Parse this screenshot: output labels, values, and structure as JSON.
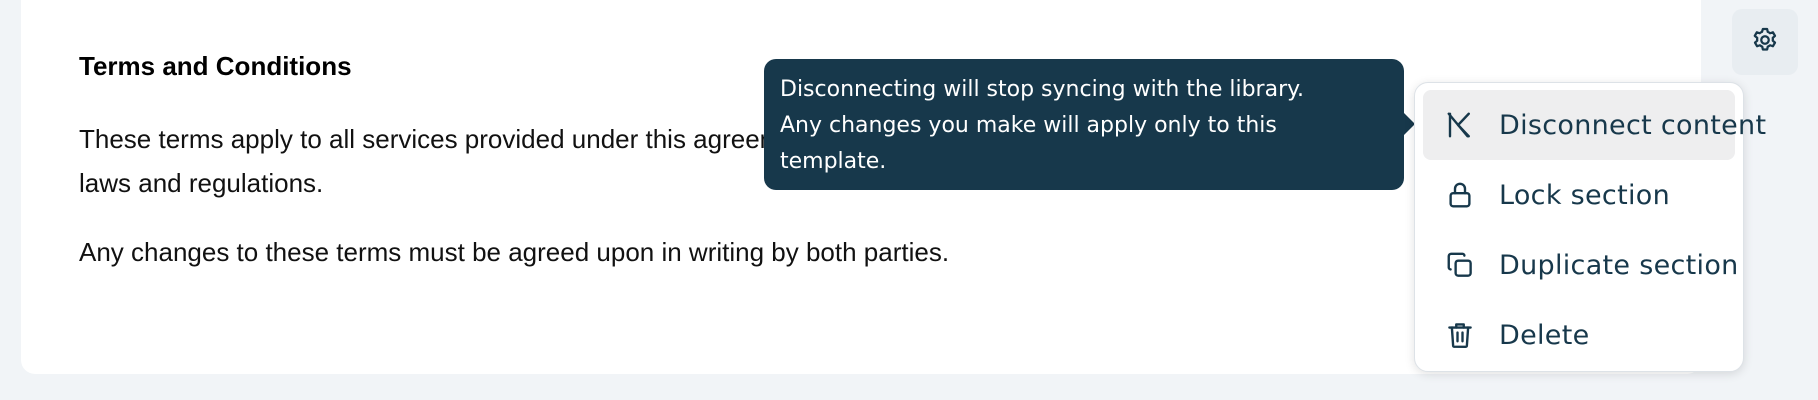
{
  "document": {
    "section_title": "Terms and Conditions",
    "paragraphs": [
      "These terms apply to all services provided under this agreement. The client agrees to comply with all applicable laws and regulations.",
      "Any changes to these terms must be agreed upon in writing by both parties."
    ]
  },
  "tooltip": {
    "lines": [
      "Disconnecting will stop syncing with the library.",
      "Any changes you make will apply only to this",
      "template."
    ]
  },
  "menu": {
    "items": [
      {
        "label": "Disconnect content",
        "icon": "disconnect-icon",
        "active": true
      },
      {
        "label": "Lock section",
        "icon": "lock-icon",
        "active": false
      },
      {
        "label": "Duplicate section",
        "icon": "duplicate-icon",
        "active": false
      },
      {
        "label": "Delete",
        "icon": "trash-icon",
        "active": false
      }
    ]
  },
  "colors": {
    "page_background": "#f1f4f7",
    "tooltip_background": "#17384b",
    "menu_text": "#17384b",
    "active_item_background": "#eeeeef",
    "gear_button_background": "#e8edf1"
  }
}
